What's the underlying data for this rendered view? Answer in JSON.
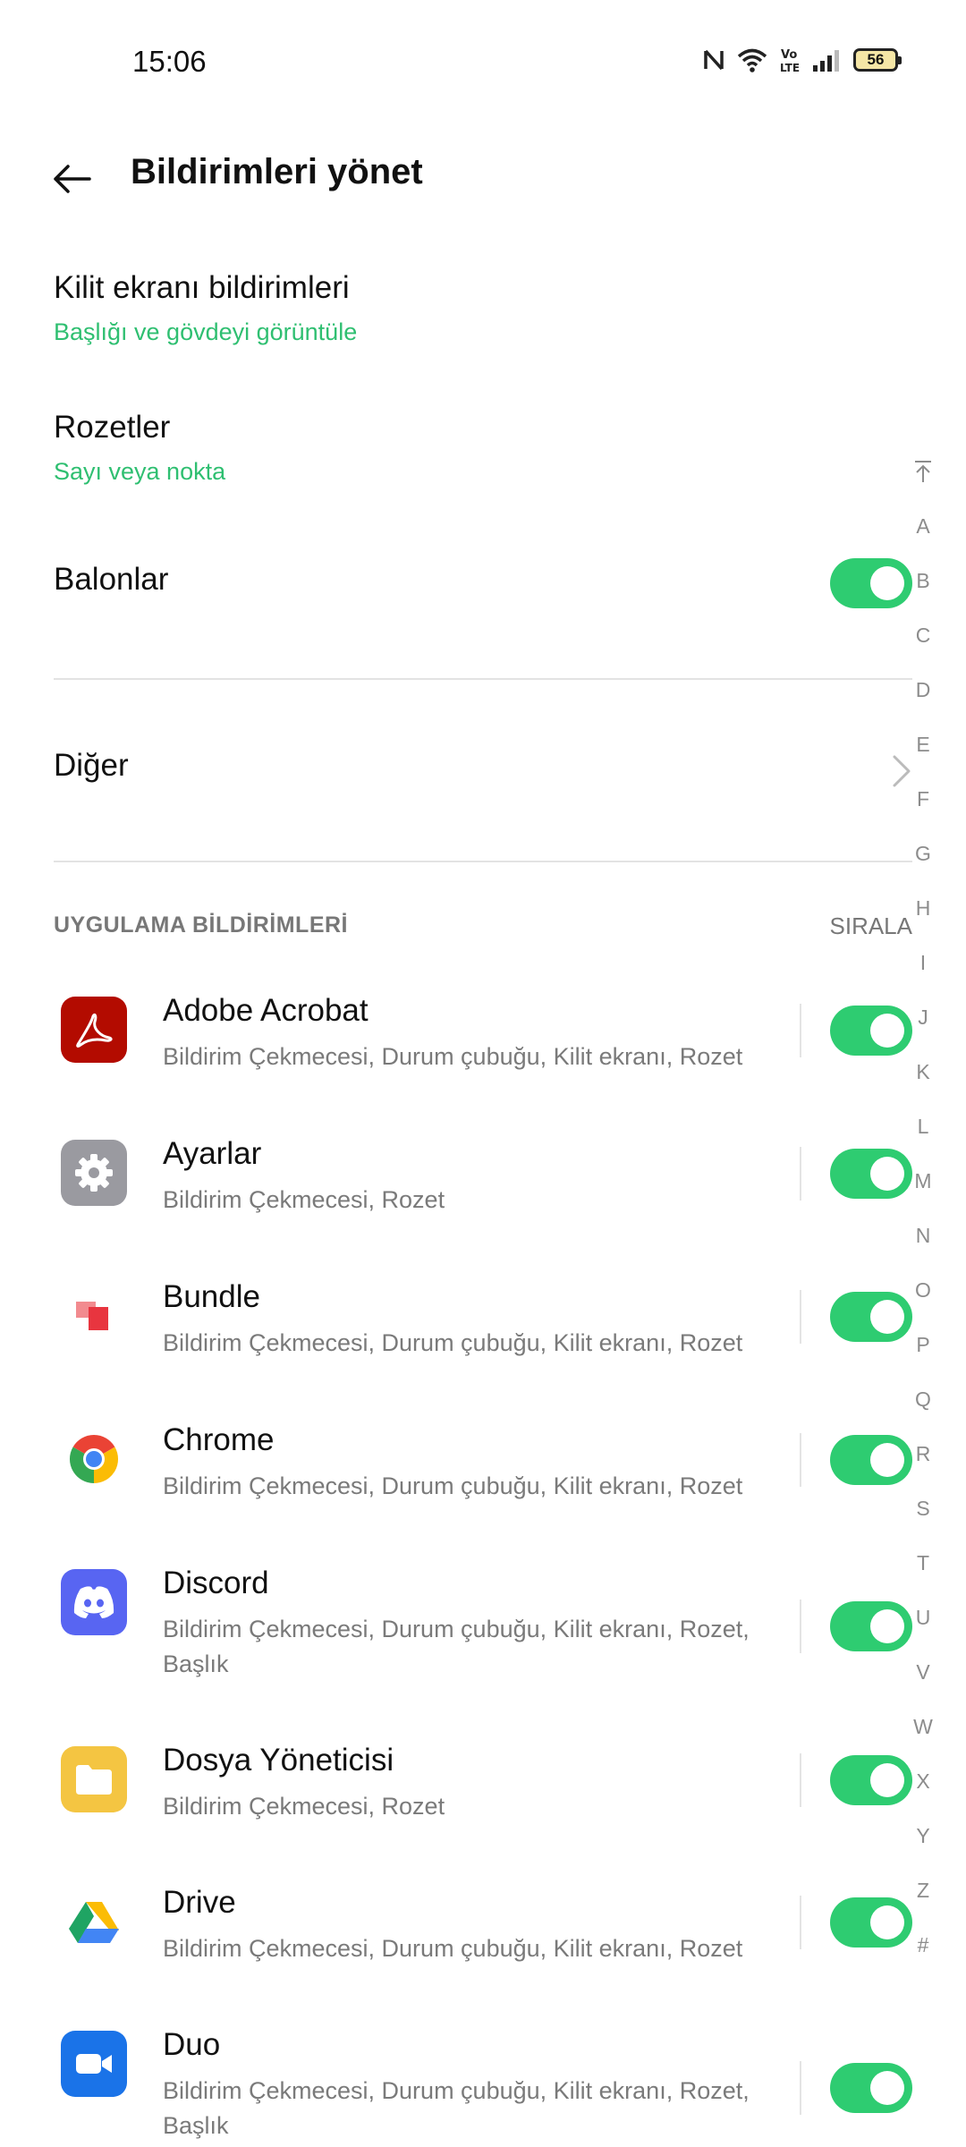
{
  "status_bar": {
    "time": "15:06",
    "battery": "56",
    "icons": [
      "nfc-icon",
      "wifi-icon",
      "volte-icon",
      "signal-icon",
      "battery-icon"
    ]
  },
  "header": {
    "title": "Bildirimleri yönet",
    "back_icon": "back-arrow-icon"
  },
  "settings": {
    "lock_screen": {
      "title": "Kilit ekranı bildirimleri",
      "value": "Başlığı ve gövdeyi görüntüle"
    },
    "badges": {
      "title": "Rozetler",
      "value": "Sayı veya nokta"
    },
    "bubbles": {
      "title": "Balonlar",
      "enabled": true
    },
    "other": {
      "title": "Diğer"
    }
  },
  "section": {
    "title": "UYGULAMA BİLDİRİMLERİ",
    "sort_label": "SIRALA"
  },
  "apps": [
    {
      "name": "Adobe Acrobat",
      "desc": "Bildirim Çekmecesi, Durum çubuğu, Kilit ekranı, Rozet",
      "enabled": true,
      "icon": "adobe-acrobat-icon",
      "color": "#b30b00"
    },
    {
      "name": "Ayarlar",
      "desc": "Bildirim Çekmecesi, Rozet",
      "enabled": true,
      "icon": "settings-gear-icon",
      "color": "#9a9aa0"
    },
    {
      "name": "Bundle",
      "desc": "Bildirim Çekmecesi, Durum çubuğu, Kilit ekranı, Rozet",
      "enabled": true,
      "icon": "bundle-icon",
      "color": "#e8353f"
    },
    {
      "name": "Chrome",
      "desc": "Bildirim Çekmecesi, Durum çubuğu, Kilit ekranı, Rozet",
      "enabled": true,
      "icon": "chrome-icon",
      "color": "#4285f4"
    },
    {
      "name": "Discord",
      "desc": "Bildirim Çekmecesi, Durum çubuğu, Kilit ekranı, Rozet, Başlık",
      "enabled": true,
      "icon": "discord-icon",
      "color": "#5865f2"
    },
    {
      "name": "Dosya Yöneticisi",
      "desc": "Bildirim Çekmecesi, Rozet",
      "enabled": true,
      "icon": "folder-icon",
      "color": "#f4c542"
    },
    {
      "name": "Drive",
      "desc": "Bildirim Çekmecesi, Durum çubuğu, Kilit ekranı, Rozet",
      "enabled": true,
      "icon": "google-drive-icon",
      "color": "#1fa463"
    },
    {
      "name": "Duo",
      "desc": "Bildirim Çekmecesi, Durum çubuğu, Kilit ekranı, Rozet, Başlık",
      "enabled": true,
      "icon": "duo-video-icon",
      "color": "#1a73e8"
    }
  ],
  "alphabet_index": [
    "A",
    "B",
    "C",
    "D",
    "E",
    "F",
    "G",
    "H",
    "I",
    "J",
    "K",
    "L",
    "M",
    "N",
    "O",
    "P",
    "Q",
    "R",
    "S",
    "T",
    "U",
    "V",
    "W",
    "X",
    "Y",
    "Z",
    "#"
  ],
  "colors": {
    "accent": "#2ecc71",
    "subtitle_green": "#2fbf71",
    "secondary_text": "#7a7a7a"
  }
}
